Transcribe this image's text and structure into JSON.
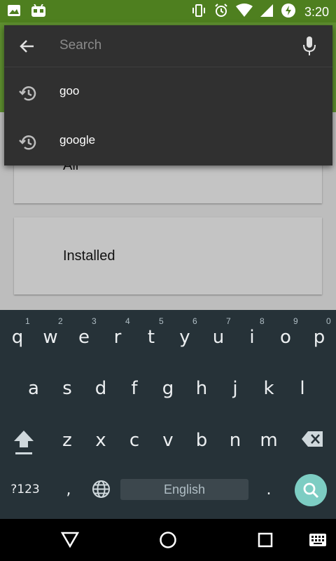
{
  "status_bar": {
    "time": "3:20",
    "icons": [
      "image-icon",
      "android-debug-icon",
      "vibrate-icon",
      "alarm-icon",
      "wifi-icon",
      "signal-icon",
      "battery-charging-icon"
    ]
  },
  "search": {
    "placeholder": "Search",
    "suggestions": [
      {
        "text": "goo",
        "icon": "history-icon"
      },
      {
        "text": "google",
        "icon": "history-icon"
      }
    ]
  },
  "cards": [
    {
      "label": "All"
    },
    {
      "label": "Installed"
    }
  ],
  "keyboard": {
    "row1": [
      {
        "key": "q",
        "hint": "1"
      },
      {
        "key": "w",
        "hint": "2"
      },
      {
        "key": "e",
        "hint": "3"
      },
      {
        "key": "r",
        "hint": "4"
      },
      {
        "key": "t",
        "hint": "5"
      },
      {
        "key": "y",
        "hint": "6"
      },
      {
        "key": "u",
        "hint": "7"
      },
      {
        "key": "i",
        "hint": "8"
      },
      {
        "key": "o",
        "hint": "9"
      },
      {
        "key": "p",
        "hint": "0"
      }
    ],
    "row2": [
      "a",
      "s",
      "d",
      "f",
      "g",
      "h",
      "j",
      "k",
      "l"
    ],
    "row3": [
      "z",
      "x",
      "c",
      "v",
      "b",
      "n",
      "m"
    ],
    "symbols_label": "?123",
    "comma": ",",
    "period": ".",
    "space_label": "English"
  },
  "colors": {
    "status_bar": "#4e7f1f",
    "keyboard_bg": "#263238",
    "search_key": "#7dcdc3",
    "overlay_bg": "#303030"
  }
}
